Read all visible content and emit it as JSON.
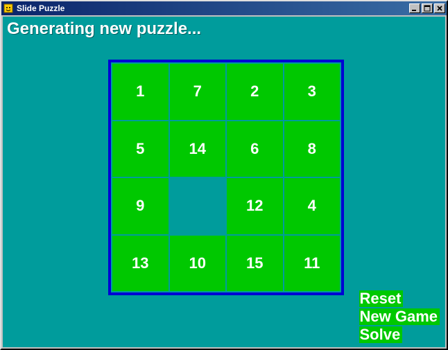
{
  "window": {
    "title": "Slide Puzzle"
  },
  "status": "Generating new puzzle...",
  "board": {
    "rows": 4,
    "cols": 4,
    "tiles": [
      "1",
      "7",
      "2",
      "3",
      "5",
      "14",
      "6",
      "8",
      "9",
      "",
      "12",
      "4",
      "13",
      "10",
      "15",
      "11"
    ]
  },
  "controls": {
    "reset": "Reset",
    "new_game": "New Game",
    "solve": "Solve"
  },
  "colors": {
    "background": "#009c9c",
    "tile": "#00c800",
    "board_border": "#0000d4",
    "text": "#ffffff"
  }
}
